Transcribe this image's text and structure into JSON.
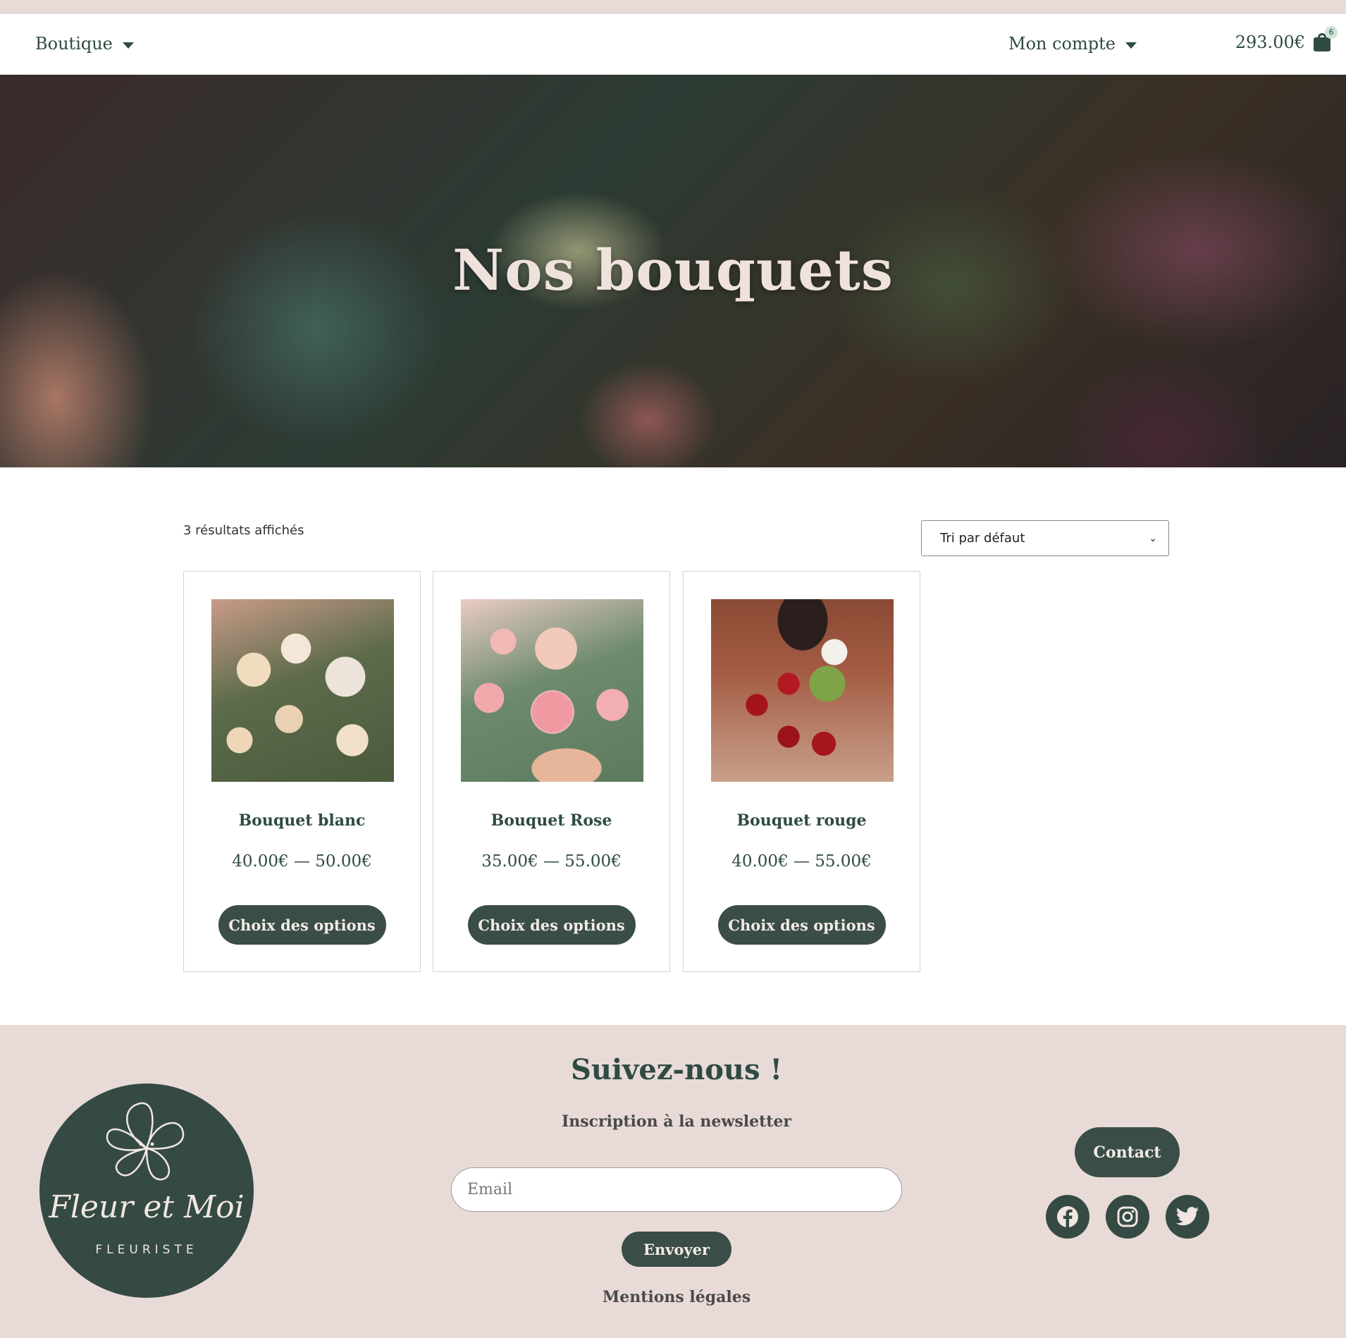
{
  "nav": {
    "shop": "Boutique",
    "account": "Mon compte",
    "cart_total": "293.00€",
    "cart_count": "6"
  },
  "hero": {
    "title": "Nos bouquets"
  },
  "shop": {
    "results": "3 résultats affichés",
    "sort_selected": "Tri par défaut"
  },
  "products": [
    {
      "name": "Bouquet blanc",
      "price": "40.00€ — 50.00€",
      "button": "Choix des options"
    },
    {
      "name": "Bouquet Rose",
      "price": "35.00€ — 55.00€",
      "button": "Choix des options"
    },
    {
      "name": "Bouquet rouge",
      "price": "40.00€ — 55.00€",
      "button": "Choix des options"
    }
  ],
  "footer": {
    "logo_script": "Fleur et Moi",
    "logo_sub": "FLEURISTE",
    "follow": "Suivez-nous !",
    "newsletter": "Inscription à la newsletter",
    "email_placeholder": "Email",
    "send": "Envoyer",
    "legal": "Mentions légales",
    "contact": "Contact",
    "social_icons": [
      "facebook-icon",
      "instagram-icon",
      "twitter-icon"
    ]
  },
  "colors": {
    "primary": "#3a4d47",
    "footer_bg": "#e8dbd7",
    "text": "#2f4b43"
  }
}
